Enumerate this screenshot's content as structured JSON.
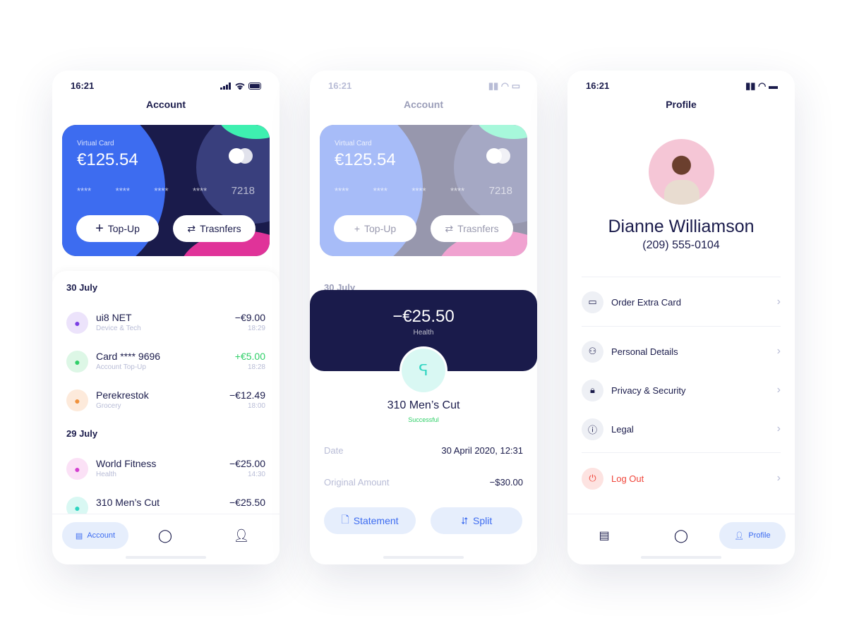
{
  "status_time": "16:21",
  "account": {
    "title": "Account",
    "card": {
      "label": "Virtual Card",
      "balance": "€125.54",
      "masked": [
        "****",
        "****",
        "****",
        "****"
      ],
      "last4": "7218",
      "topup": "Top-Up",
      "transfers": "Trasnfers"
    },
    "groups": [
      {
        "date": "30 July",
        "items": [
          {
            "name": "ui8 NET",
            "sub": "Device & Tech",
            "amount": "−€9.00",
            "time": "18:29",
            "icon": "monitor-icon",
            "bg": "#ece3fb",
            "fg": "#7b3fe4"
          },
          {
            "name": "Card **** 9696",
            "sub": "Account Top-Up",
            "amount": "+€5.00",
            "time": "18:28",
            "icon": "plus-icon",
            "bg": "#ddf7e6",
            "fg": "#2fcf68"
          },
          {
            "name": "Perekrestok",
            "sub": "Grocery",
            "amount": "−€12.49",
            "time": "18:00",
            "icon": "hanger-icon",
            "bg": "#fdeadb",
            "fg": "#f0913c"
          }
        ]
      },
      {
        "date": "29 July",
        "items": [
          {
            "name": "World Fitness",
            "sub": "Health",
            "amount": "−€25.00",
            "time": "14:30",
            "icon": "pool-icon",
            "bg": "#fbe1f6",
            "fg": "#d43fd0"
          },
          {
            "name": "310 Men’s Cut",
            "sub": "",
            "amount": "−€25.50",
            "time": "",
            "icon": "hairdryer-icon",
            "bg": "#d9f8f3",
            "fg": "#2dd4c0"
          }
        ]
      }
    ],
    "nav_account": "Account"
  },
  "detail": {
    "amount": "−€25.50",
    "category": "Health",
    "merchant": "310 Men’s Cut",
    "status": "Successful",
    "date_label": "Date",
    "date_value": "30 April 2020, 12:31",
    "orig_label": "Original Amount",
    "orig_value": "−$30.00",
    "statement": "Statement",
    "split": "Split",
    "peek_date": "30 July"
  },
  "profile": {
    "title": "Profile",
    "name": "Dianne Williamson",
    "phone": "(209) 555-0104",
    "menu": [
      "Order Extra Card",
      "Personal Details",
      "Privacy & Security",
      "Legal"
    ],
    "logout": "Log Out",
    "nav_profile": "Profile"
  },
  "colors": {
    "navy": "#1a1b4b",
    "blue": "#3d6cf0",
    "green": "#2fcf68",
    "red": "#f0453a"
  }
}
